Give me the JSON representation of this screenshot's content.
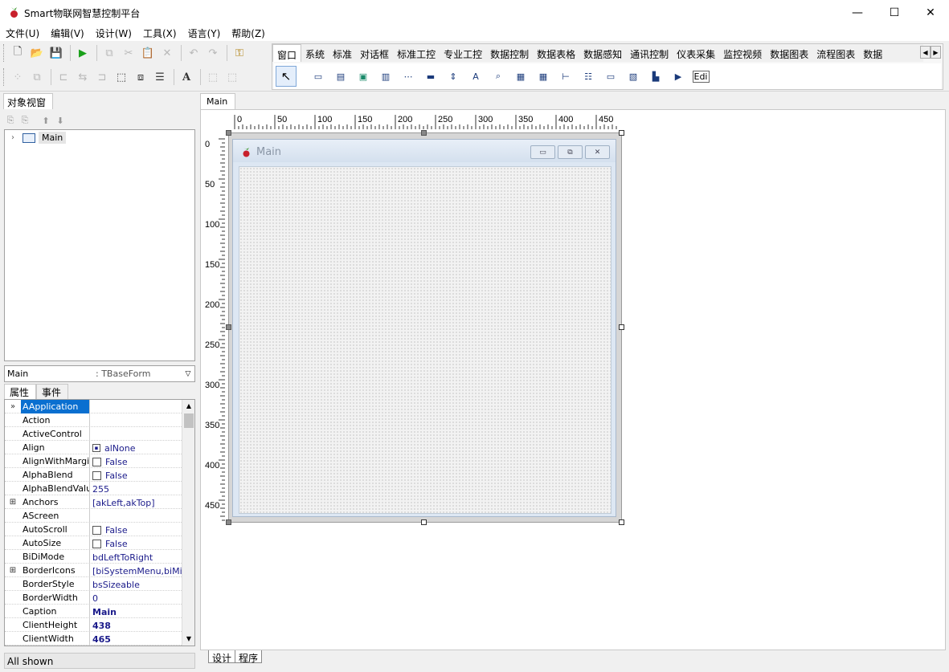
{
  "window": {
    "title": "Smart物联网智慧控制平台",
    "min_icon": "minimize-icon",
    "max_icon": "maximize-icon",
    "close_icon": "close-icon"
  },
  "menu": [
    "文件(U)",
    "编辑(V)",
    "设计(W)",
    "工具(X)",
    "语言(Y)",
    "帮助(Z)"
  ],
  "palette": {
    "tabs": [
      "窗口",
      "系统",
      "标准",
      "对话框",
      "标准工控",
      "专业工控",
      "数据控制",
      "数据表格",
      "数据感知",
      "通讯控制",
      "仪表采集",
      "监控视频",
      "数据图表",
      "流程图表",
      "数据"
    ],
    "active_tab": "窗口",
    "last_comp_label": "Edi"
  },
  "object_view": {
    "title": "对象视窗",
    "tree_root": "Main",
    "selected_name": "Main",
    "selected_type": ": TBaseForm",
    "inspector_tabs": [
      "属性",
      "事件"
    ],
    "properties": [
      {
        "name": "AApplication",
        "value": "",
        "kind": "text",
        "selected": true,
        "gutter": "»"
      },
      {
        "name": "Action",
        "value": "",
        "kind": "text"
      },
      {
        "name": "ActiveControl",
        "value": "",
        "kind": "text"
      },
      {
        "name": "Align",
        "value": "alNone",
        "kind": "align"
      },
      {
        "name": "AlignWithMargins",
        "value": "False",
        "kind": "check"
      },
      {
        "name": "AlphaBlend",
        "value": "False",
        "kind": "check"
      },
      {
        "name": "AlphaBlendValue",
        "value": "255",
        "kind": "text"
      },
      {
        "name": "Anchors",
        "value": "[akLeft,akTop]",
        "kind": "text",
        "gutter": "⊞"
      },
      {
        "name": "AScreen",
        "value": "",
        "kind": "text"
      },
      {
        "name": "AutoScroll",
        "value": "False",
        "kind": "check"
      },
      {
        "name": "AutoSize",
        "value": "False",
        "kind": "check"
      },
      {
        "name": "BiDiMode",
        "value": "bdLeftToRight",
        "kind": "text"
      },
      {
        "name": "BorderIcons",
        "value": "[biSystemMenu,biMinin",
        "kind": "text",
        "gutter": "⊞"
      },
      {
        "name": "BorderStyle",
        "value": "bsSizeable",
        "kind": "text"
      },
      {
        "name": "BorderWidth",
        "value": "0",
        "kind": "text"
      },
      {
        "name": "Caption",
        "value": "Main",
        "kind": "bold"
      },
      {
        "name": "ClientHeight",
        "value": "438",
        "kind": "bold"
      },
      {
        "name": "ClientWidth",
        "value": "465",
        "kind": "bold"
      }
    ],
    "status": "All shown"
  },
  "design": {
    "tab": "Main",
    "form_caption": "Main",
    "bottom_tabs": [
      "设计",
      "程序"
    ],
    "ruler_h": [
      "0",
      "50",
      "100",
      "150",
      "200",
      "250",
      "300",
      "350",
      "400",
      "450"
    ],
    "ruler_v": [
      "0",
      "50",
      "100",
      "150",
      "200",
      "250",
      "300",
      "350",
      "400",
      "450"
    ]
  }
}
